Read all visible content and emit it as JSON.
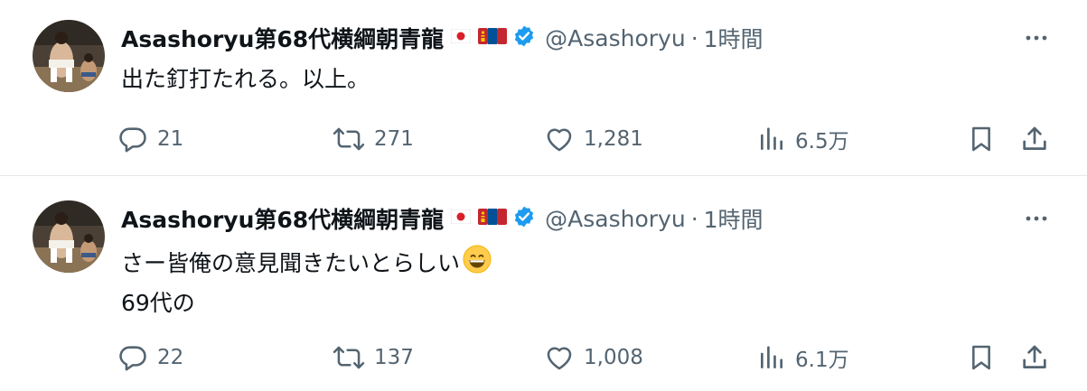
{
  "tweets": [
    {
      "display_name": "Asashoryu第68代横綱朝青龍",
      "handle": "@Asashoryu",
      "separator": "·",
      "time": "1時間",
      "text_lines": [
        "出た釘打たれる。以上。"
      ],
      "replies": "21",
      "retweets": "271",
      "likes": "1,281",
      "views": "6.5万"
    },
    {
      "display_name": "Asashoryu第68代横綱朝青龍",
      "handle": "@Asashoryu",
      "separator": "·",
      "time": "1時間",
      "text_lines": [
        "さー皆俺の意見聞きたいとらしい",
        "69代の"
      ],
      "replies": "22",
      "retweets": "137",
      "likes": "1,008",
      "views": "6.1万"
    }
  ],
  "icons": {
    "flags": [
      "japan-flag-icon",
      "mongolia-flag-icon"
    ],
    "verified": "verified-badge-icon",
    "more": "more-icon",
    "emoji": "grinning-face-emoji",
    "actions": [
      "reply-icon",
      "retweet-icon",
      "like-icon",
      "views-icon",
      "bookmark-icon",
      "share-icon"
    ]
  },
  "colors": {
    "text": "#0f1419",
    "secondary": "#536471",
    "verified": "#1d9bf0",
    "divider": "#e6e9eb"
  }
}
